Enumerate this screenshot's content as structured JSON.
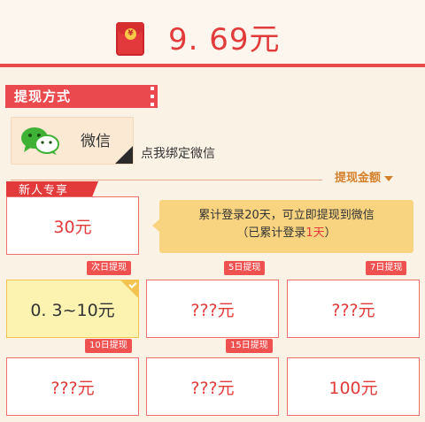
{
  "header": {
    "amount": "9. 69元",
    "packet_symbol": "¥"
  },
  "section": {
    "title": "提现方式"
  },
  "wechat": {
    "label": "微信",
    "bind_link": "点我绑定微信"
  },
  "withdraw": {
    "amount_label": "提现金额"
  },
  "newbie": {
    "tag": "新人专享",
    "card_value": "30元",
    "tip_line1": "累计登录20天，可立即提现到微信",
    "tip_line2_prefix": "（已累计登录",
    "tip_line2_highlight": "1天",
    "tip_line2_suffix": "）"
  },
  "options": [
    {
      "badge": "次日提现",
      "value": "0. 3~10元",
      "selected": true
    },
    {
      "badge": "5日提现",
      "value": "???元",
      "selected": false
    },
    {
      "badge": "7日提现",
      "value": "???元",
      "selected": false
    },
    {
      "badge": "10日提现",
      "value": "???元",
      "selected": false
    },
    {
      "badge": "15日提现",
      "value": "???元",
      "selected": false
    },
    {
      "badge": "",
      "value": "100元",
      "selected": false
    }
  ],
  "colors": {
    "accent": "#e23b3b",
    "selected_fill": "#fdf3b0",
    "tip_fill": "#f9d480"
  }
}
